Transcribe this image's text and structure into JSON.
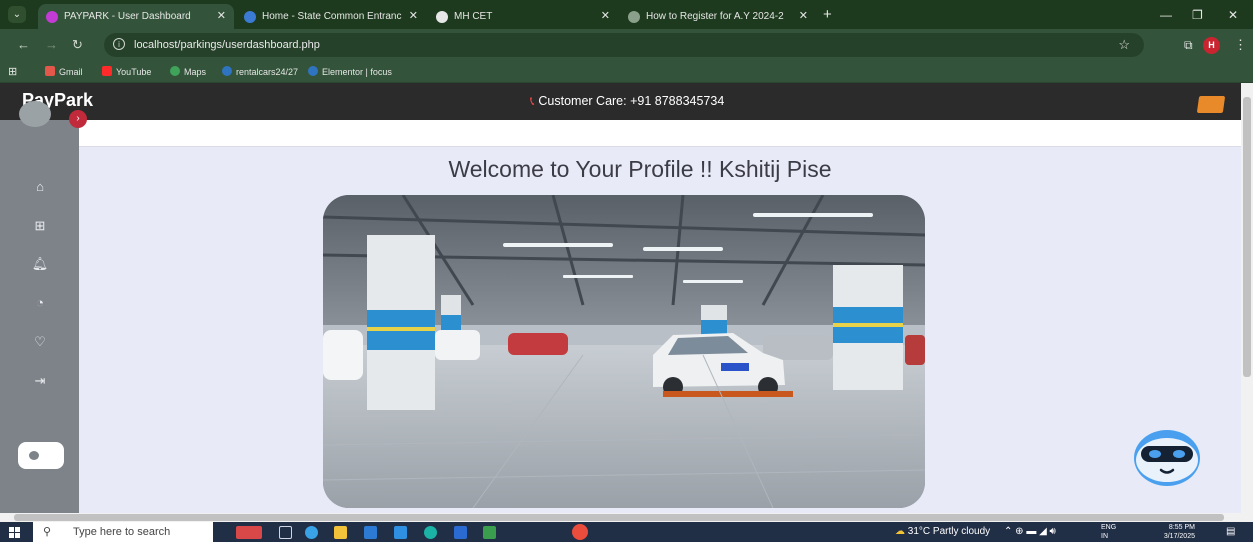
{
  "browser": {
    "tabs": [
      {
        "title": "PAYPARK - User Dashboard",
        "active": true,
        "favicon_color": "#c23bd4"
      },
      {
        "title": "Home - State Common Entranc",
        "active": false,
        "favicon_color": "#3b7bd4"
      },
      {
        "title": "MH CET",
        "active": false,
        "favicon_color": "#e6e6e6"
      },
      {
        "title": "How to Register for A.Y 2024-2",
        "active": false,
        "favicon_color": "#8aa08a"
      }
    ],
    "url": "localhost/parkings/userdashboard.php",
    "profile_initial": "H",
    "bookmarks": [
      {
        "label": "Gmail",
        "icon": "gmail-icon"
      },
      {
        "label": "YouTube",
        "icon": "youtube-icon"
      },
      {
        "label": "Maps",
        "icon": "maps-icon"
      },
      {
        "label": "rentalcars24/27",
        "icon": "wordpress-icon"
      },
      {
        "label": "Elementor | focus",
        "icon": "wordpress-icon"
      }
    ]
  },
  "site": {
    "logo": "PayPark",
    "customer_care": "Customer Care: +91 8788345734",
    "welcome": "Welcome to Your Profile !! Kshitij Pise",
    "sidebar_icons": [
      "home-icon",
      "dashboard-icon",
      "bell-icon",
      "history-icon",
      "favorite-icon",
      "logout-icon"
    ],
    "hero_image": "parking-garage-photo"
  },
  "taskbar": {
    "search_placeholder": "Type here to search",
    "weather": "31°C  Partly cloudy",
    "language": "ENG",
    "region": "IN",
    "time": "8:55 PM",
    "date": "3/17/2025"
  },
  "colors": {
    "tab_bar": "#1e3a1e",
    "toolbar": "#33543a",
    "site_header": "#2b2b2b",
    "sidebar": "#7e838a",
    "page_bg": "#e8ebf7",
    "phone_accent": "#e44a4a"
  }
}
